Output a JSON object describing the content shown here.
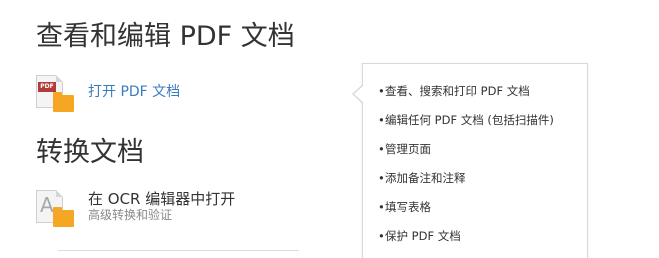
{
  "sections": {
    "view_edit": {
      "heading": "查看和编辑 PDF 文档",
      "open_pdf_label": "打开 PDF 文档",
      "open_pdf_icon": "pdf-file-folder-icon"
    },
    "convert": {
      "heading": "转换文档",
      "ocr_title": "在 OCR 编辑器中打开",
      "ocr_subtitle": "高级转换和验证",
      "ocr_icon": "ocr-file-folder-icon"
    }
  },
  "tooltip": {
    "bullet": "•",
    "items": [
      "查看、搜索和打印 PDF 文档",
      "编辑任何 PDF 文档 (包括扫描件)",
      "管理页面",
      "添加备注和注释",
      "填写表格",
      "保护 PDF 文档"
    ]
  },
  "icons": {
    "pdf_badge_text": "PDF",
    "ocr_letter": "A"
  },
  "colors": {
    "link": "#3a7bbf",
    "folder": "#f5a623",
    "pdf_badge": "#b33a3a",
    "heading": "#333333",
    "subtitle": "#8a8a8a"
  }
}
